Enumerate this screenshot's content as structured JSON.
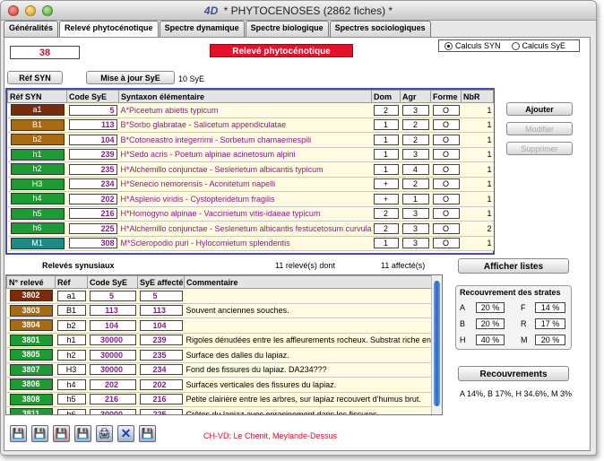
{
  "window": {
    "logo": "4D",
    "title": "* PHYTOCENOSES (2862 fiches) *"
  },
  "tabs": [
    "Généralités",
    "Relevé phytocénotique",
    "Spectre dynamique",
    "Spectre biologique",
    "Spectres sociologiques"
  ],
  "active_tab": 1,
  "record_number": "38",
  "banner": "Relevé phytocénotique",
  "calc": {
    "options": [
      "Calculs SYN",
      "Calculs SyE"
    ],
    "selected": 0
  },
  "toolbar": {
    "ref_syn_button": "Réf SYN",
    "update_button": "Mise à jour SyE",
    "sye_count": "10 SyE"
  },
  "syn_table": {
    "headers": [
      "Réf SYN",
      "Code SyE",
      "Syntaxon élémentaire",
      "Dom",
      "Agr",
      "Forme",
      "NbR"
    ],
    "rows": [
      {
        "ref": "a1",
        "color": "#7b2b0c",
        "code": "5",
        "name": "A*Piceetum abietis typicum",
        "dom": "2",
        "agr": "3",
        "forme": "O",
        "nbr": "1"
      },
      {
        "ref": "B1",
        "color": "#a86a12",
        "code": "113",
        "name": "B*Sorbo glabratae - Salicetum appendiculatae",
        "dom": "1",
        "agr": "2",
        "forme": "O",
        "nbr": "1"
      },
      {
        "ref": "b2",
        "color": "#a86a12",
        "code": "104",
        "name": "B*Cotoneastro integerrimi - Sorbetum chamaemespili",
        "dom": "1",
        "agr": "2",
        "forme": "O",
        "nbr": "1"
      },
      {
        "ref": "h1",
        "color": "#1e9a34",
        "code": "239",
        "name": "H*Sedo acris - Poetum alpinae acinetosum alpini",
        "dom": "1",
        "agr": "3",
        "forme": "O",
        "nbr": "1"
      },
      {
        "ref": "h2",
        "color": "#1e9a34",
        "code": "235",
        "name": "H*Alchemillo conjunctae - Seslerietum albicantis typicum",
        "dom": "1",
        "agr": "4",
        "forme": "O",
        "nbr": "1"
      },
      {
        "ref": "H3",
        "color": "#1e9a34",
        "code": "234",
        "name": "H*Senecio nemorensis - Aconitetum napelli",
        "dom": "+",
        "agr": "2",
        "forme": "O",
        "nbr": "1"
      },
      {
        "ref": "h4",
        "color": "#1e9a34",
        "code": "202",
        "name": "H*Asplenio viridis - Cystopteridetum fragilis",
        "dom": "+",
        "agr": "1",
        "forme": "O",
        "nbr": "1"
      },
      {
        "ref": "h5",
        "color": "#1e9a34",
        "code": "216",
        "name": "H*Homogyno alpinae - Vaccinietum vitis-idaeae typicum",
        "dom": "2",
        "agr": "3",
        "forme": "O",
        "nbr": "1"
      },
      {
        "ref": "h6",
        "color": "#1e9a34",
        "code": "225",
        "name": "H*Alchemillo conjunctae - Seslerietum albicantis festucetosum curvulae",
        "dom": "2",
        "agr": "3",
        "forme": "O",
        "nbr": "2"
      },
      {
        "ref": "M1",
        "color": "#1d8a86",
        "code": "308",
        "name": "M*Scleropodio puri - Hylocomietum splendentis",
        "dom": "1",
        "agr": "3",
        "forme": "O",
        "nbr": "1"
      }
    ]
  },
  "side_buttons": {
    "add": "Ajouter",
    "modify": "Modifier",
    "delete": "Supprimer"
  },
  "releves": {
    "title": "Relevés synusiaux",
    "count_text": "11 relevé(s) dont",
    "affected_text": "11 affecté(s)",
    "headers": [
      "N° relevé",
      "Réf",
      "Code SyE",
      "SyE affecté",
      "Commentaire"
    ],
    "rows": [
      {
        "num": "3802",
        "color": "#7b2b0c",
        "ref": "a1",
        "code": "5",
        "affected": "5",
        "comment": ""
      },
      {
        "num": "3803",
        "color": "#a86a12",
        "ref": "B1",
        "code": "113",
        "affected": "113",
        "comment": "Souvent anciennes souches."
      },
      {
        "num": "3804",
        "color": "#a86a12",
        "ref": "b2",
        "code": "104",
        "affected": "104",
        "comment": ""
      },
      {
        "num": "3801",
        "color": "#1e9a34",
        "ref": "h1",
        "code": "30000",
        "affected": "239",
        "comment": "Rigoles dénudées entre les affleurements rocheux. Substrat riche en h"
      },
      {
        "num": "3805",
        "color": "#1e9a34",
        "ref": "h2",
        "code": "30000",
        "affected": "235",
        "comment": "Surface des dalles du lapiaz."
      },
      {
        "num": "3807",
        "color": "#1e9a34",
        "ref": "H3",
        "code": "30000",
        "affected": "234",
        "comment": "Fond des fissures du lapiaz. DA234???"
      },
      {
        "num": "3806",
        "color": "#1e9a34",
        "ref": "h4",
        "code": "202",
        "affected": "202",
        "comment": "Surfaces verticales des fissures du lapiaz."
      },
      {
        "num": "3808",
        "color": "#1e9a34",
        "ref": "h5",
        "code": "216",
        "affected": "216",
        "comment": "Petite clairière entre les arbres, sur lapiaz recouvert d'humus brut."
      },
      {
        "num": "3811",
        "color": "#1e9a34",
        "ref": "h6",
        "code": "30000",
        "affected": "225",
        "comment": "Crêtes du lapiaz avec enracinement dans les fissures."
      }
    ]
  },
  "show_lists_button": "Afficher listes",
  "strata": {
    "title": "Recouvrement des strates",
    "items": [
      {
        "label": "A",
        "value": "20 %"
      },
      {
        "label": "F",
        "value": "14 %"
      },
      {
        "label": "B",
        "value": "20 %"
      },
      {
        "label": "R",
        "value": "17 %"
      },
      {
        "label": "H",
        "value": "40 %"
      },
      {
        "label": "M",
        "value": "20 %"
      }
    ]
  },
  "recouvrements_button": "Recouvrements",
  "recouvrements_summary": "A 14%, B 17%, H 34.6%, M 3%",
  "location": "CH-VD: Le Chenit, Meylande-Dessus",
  "colors": {
    "banner": "#e5102a",
    "frame": "#4a4aa8",
    "code_purple": "#8b1a8b",
    "cream": "#fffbe0"
  },
  "tool_icons": [
    "floppy-icon",
    "floppy-icon",
    "floppy-red-icon",
    "floppy-icon",
    "printer-icon",
    "delete-x-icon",
    "floppy-icon"
  ]
}
